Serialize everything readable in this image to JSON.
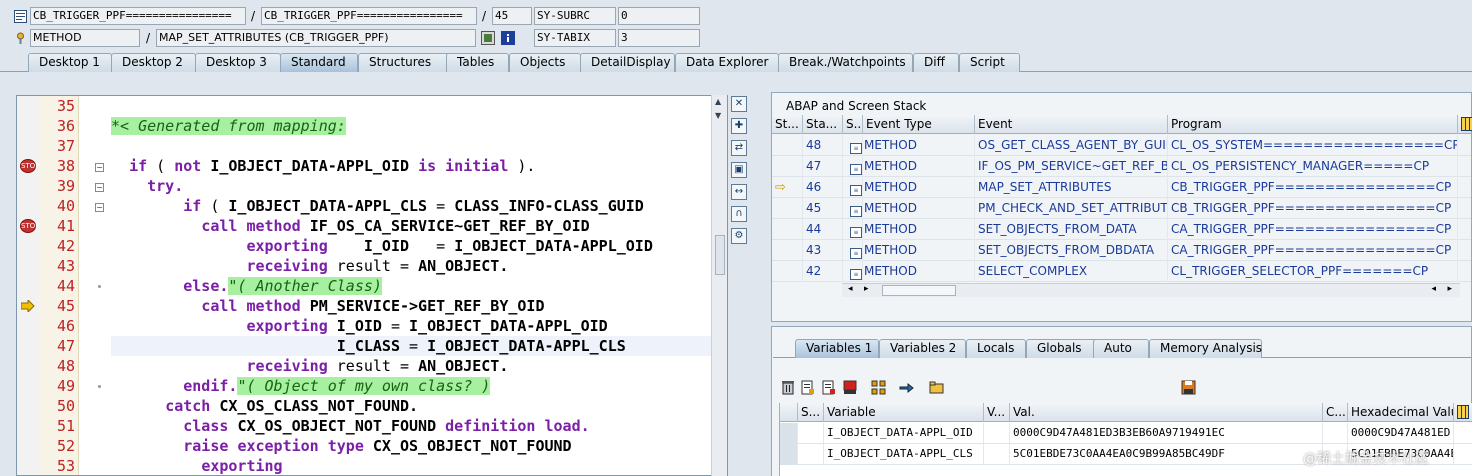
{
  "header": {
    "row1": {
      "program": "CB_TRIGGER_PPF================",
      "include": "CB_TRIGGER_PPF================",
      "line": "45",
      "sysvar": "SY-SUBRC",
      "sysval": "0"
    },
    "row2": {
      "event_type": "METHOD",
      "event": "MAP_SET_ATTRIBUTES (CB_TRIGGER_PPF)",
      "sysvar": "SY-TABIX",
      "sysval": "3"
    }
  },
  "tabs": [
    "Desktop 1",
    "Desktop 2",
    "Desktop 3",
    "Standard",
    "Structures",
    "Tables",
    "Objects",
    "DetailDisplay",
    "Data Explorer",
    "Break./Watchpoints",
    "Diff",
    "Script"
  ],
  "active_tab": "Standard",
  "code": {
    "lines": [
      {
        "n": "35",
        "text": ""
      },
      {
        "n": "36",
        "text": "*< Generated from mapping:",
        "type": "comment",
        "indent": 0
      },
      {
        "n": "37",
        "text": ""
      },
      {
        "n": "38",
        "text": "if ( not I_OBJECT_DATA-APPL_OID is initial ).",
        "indent": 2
      },
      {
        "n": "39",
        "text": "try.",
        "indent": 4
      },
      {
        "n": "40",
        "text": "if ( I_OBJECT_DATA-APPL_CLS = CLASS_INFO-CLASS_GUID",
        "indent": 8
      },
      {
        "n": "41",
        "text": "call method IF_OS_CA_SERVICE~GET_REF_BY_OID",
        "indent": 10
      },
      {
        "n": "42",
        "text": "exporting    I_OID   = I_OBJECT_DATA-APPL_OID",
        "indent": 15
      },
      {
        "n": "43",
        "text": "receiving result = AN_OBJECT.",
        "indent": 15
      },
      {
        "n": "44",
        "text": "else.",
        "comment": "\"( Another Class)",
        "indent": 8
      },
      {
        "n": "45",
        "text": "call method PM_SERVICE->GET_REF_BY_OID",
        "indent": 10
      },
      {
        "n": "46",
        "text": "exporting I_OID = I_OBJECT_DATA-APPL_OID",
        "indent": 15
      },
      {
        "n": "47",
        "text": "I_CLASS = I_OBJECT_DATA-APPL_CLS",
        "indent": 25
      },
      {
        "n": "48",
        "text": "receiving result = AN_OBJECT.",
        "indent": 15
      },
      {
        "n": "49",
        "text": "endif.",
        "comment": "\"( Object of my own class? )",
        "indent": 8
      },
      {
        "n": "50",
        "text": "catch CX_OS_CLASS_NOT_FOUND.",
        "indent": 6
      },
      {
        "n": "51",
        "text": "class CX_OS_OBJECT_NOT_FOUND definition load.",
        "indent": 8
      },
      {
        "n": "52",
        "text": "raise exception type CX_OS_OBJECT_NOT_FOUND",
        "indent": 8
      },
      {
        "n": "53",
        "text": "exporting",
        "indent": 10
      }
    ]
  },
  "stack": {
    "title": "ABAP and Screen Stack",
    "columns": [
      "St...",
      "Sta...",
      "S...",
      "Event Type",
      "Event",
      "Program"
    ],
    "rows": [
      {
        "level": "48",
        "type": "METHOD",
        "event": "OS_GET_CLASS_AGENT_BY_GUID",
        "program": "CL_OS_SYSTEM==================CP"
      },
      {
        "level": "47",
        "type": "METHOD",
        "event": "IF_OS_PM_SERVICE~GET_REF_B...",
        "program": "CL_OS_PERSISTENCY_MANAGER=====CP"
      },
      {
        "level": "46",
        "type": "METHOD",
        "event": "MAP_SET_ATTRIBUTES",
        "program": "CB_TRIGGER_PPF================CP",
        "current": true
      },
      {
        "level": "45",
        "type": "METHOD",
        "event": "PM_CHECK_AND_SET_ATTRIBUT...",
        "program": "CB_TRIGGER_PPF================CP"
      },
      {
        "level": "44",
        "type": "METHOD",
        "event": "SET_OBJECTS_FROM_DATA",
        "program": "CA_TRIGGER_PPF================CP"
      },
      {
        "level": "43",
        "type": "METHOD",
        "event": "SET_OBJECTS_FROM_DBDATA",
        "program": "CA_TRIGGER_PPF================CP"
      },
      {
        "level": "42",
        "type": "METHOD",
        "event": "SELECT_COMPLEX",
        "program": "CL_TRIGGER_SELECTOR_PPF=======CP"
      }
    ]
  },
  "var_tabs": [
    "Variables 1",
    "Variables 2",
    "Locals",
    "Globals",
    "Auto",
    "Memory Analysis"
  ],
  "active_var_tab": "Variables 1",
  "variables": {
    "columns": [
      "S...",
      "Variable",
      "V...",
      "Val.",
      "C...",
      "Hexadecimal Value"
    ],
    "rows": [
      {
        "name": "I_OBJECT_DATA-APPL_OID",
        "value": "0000C9D47A481ED3B3EB60A9719491EC",
        "hex": "0000C9D47A481ED"
      },
      {
        "name": "I_OBJECT_DATA-APPL_CLS",
        "value": "5C01EBDE73C0AA4EA0C9B99A85BC49DF",
        "hex": "5C01EBDE73C0AA4E"
      }
    ]
  },
  "watermark": "@稀土掘金技术社区"
}
